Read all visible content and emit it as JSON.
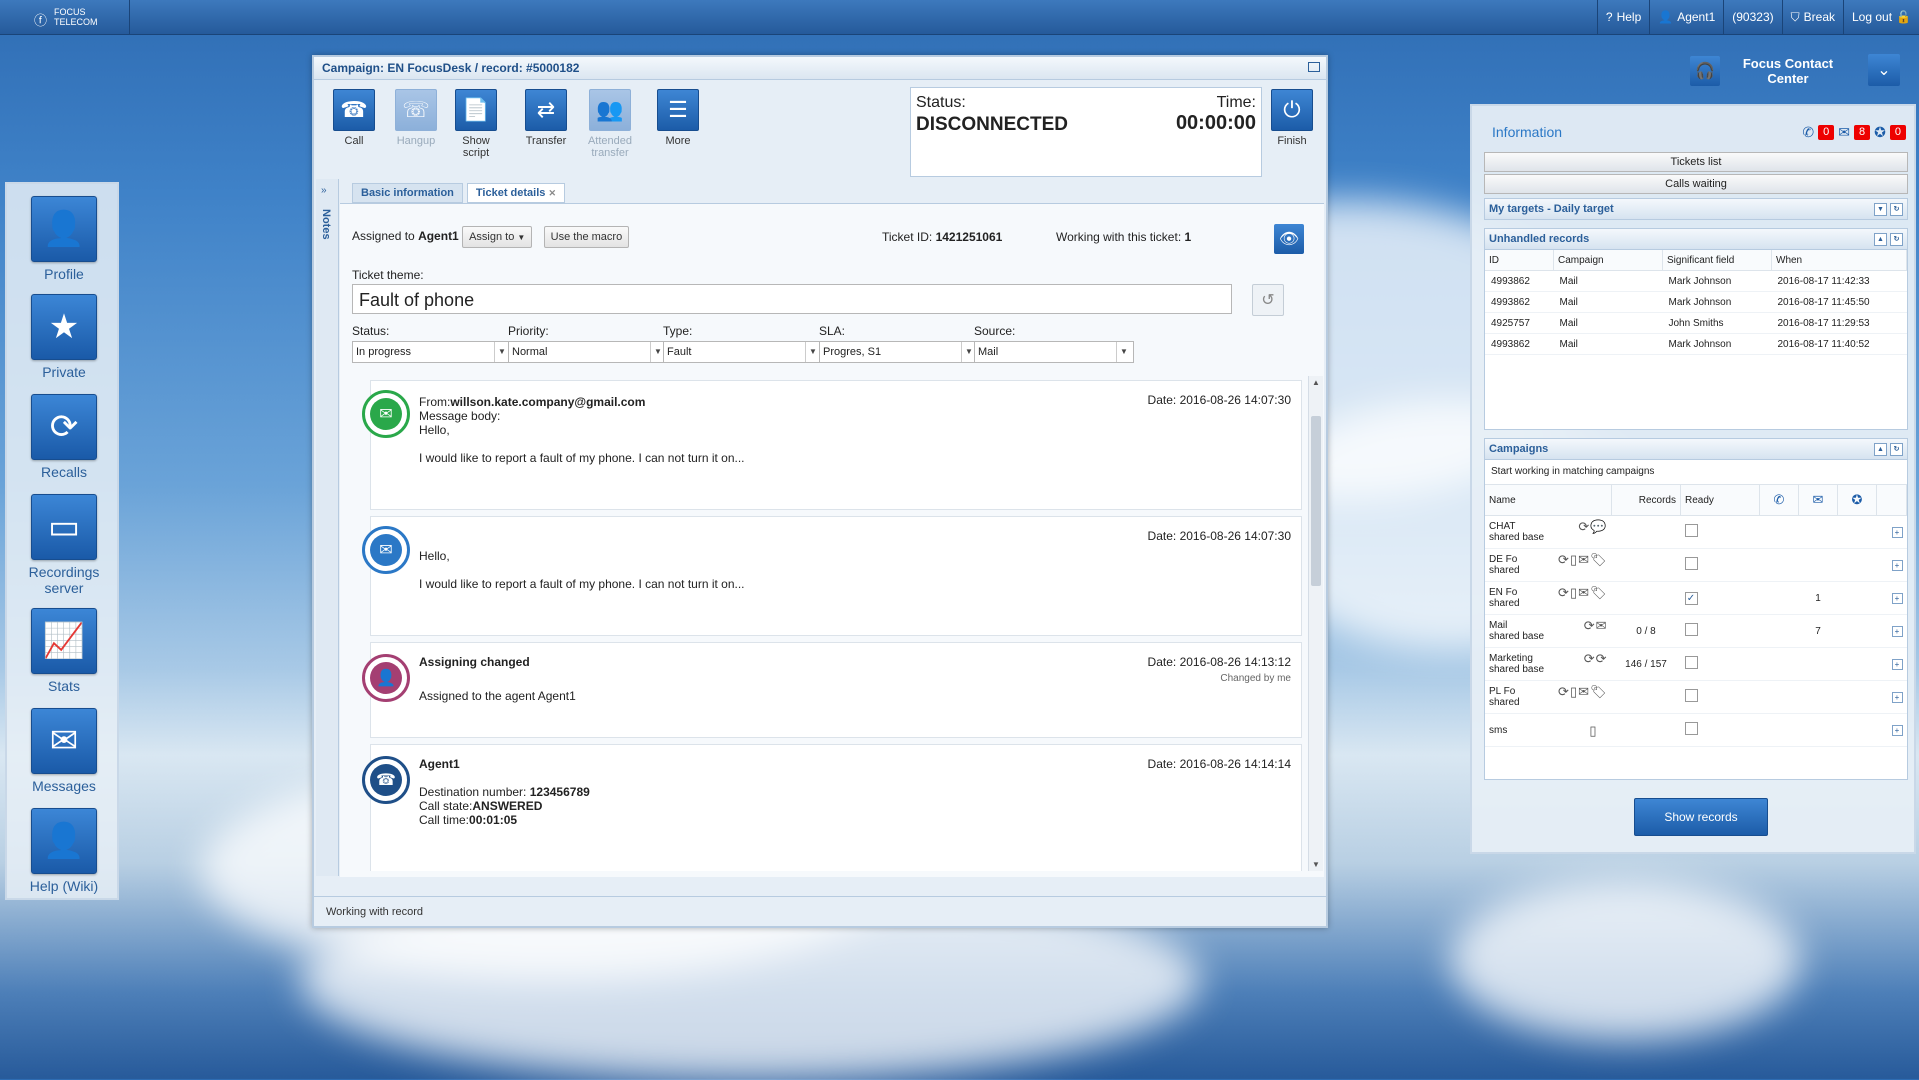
{
  "topbar": {
    "logo_text": "FOCUS TELECOM",
    "help": "Help",
    "agent": "Agent1",
    "agent_id": "(90323)",
    "break": "Break",
    "logout": "Log out"
  },
  "dock": [
    {
      "label": "Profile",
      "icon": "user-icon"
    },
    {
      "label": "Private",
      "icon": "star-icon"
    },
    {
      "label": "Recalls",
      "icon": "recall-icon"
    },
    {
      "label": "Recordings server",
      "icon": "tape-icon"
    },
    {
      "label": "Stats",
      "icon": "chart-icon"
    },
    {
      "label": "Messages",
      "icon": "message-icon"
    },
    {
      "label": "Help (Wiki)",
      "icon": "user-icon"
    }
  ],
  "window": {
    "title": "Campaign: EN FocusDesk / record: #5000182",
    "toolbar": {
      "call": "Call",
      "hangup": "Hangup",
      "show_script": "Show script",
      "transfer": "Transfer",
      "attended_transfer": "Attended transfer",
      "more": "More",
      "finish": "Finish"
    },
    "status_label": "Status:",
    "status_value": "DISCONNECTED",
    "time_label": "Time:",
    "time_value": "00:00:00",
    "notes_label": "Notes",
    "tabs": [
      "Basic information",
      "Ticket details"
    ],
    "assigned_prefix": "Assigned to",
    "assigned_agent": "Agent1",
    "assign_to": "Assign to",
    "use_macro": "Use the macro",
    "ticket_id_label": "Ticket ID:",
    "ticket_id": "1421251061",
    "working_label": "Working with this ticket:",
    "working_count": "1",
    "theme_label": "Ticket theme:",
    "theme_value": "Fault of phone",
    "fields": [
      {
        "label": "Status:",
        "value": "In progress"
      },
      {
        "label": "Priority:",
        "value": "Normal"
      },
      {
        "label": "Type:",
        "value": "Fault"
      },
      {
        "label": "SLA:",
        "value": "Progres, S1"
      },
      {
        "label": "Source:",
        "value": "Mail"
      }
    ],
    "timeline": {
      "e1": {
        "from_prefix": "From:",
        "from": "willson.kate.company@gmail.com",
        "body_label": "Message body:",
        "hello": "Hello,",
        "text": "I would like to report a fault of my phone. I can not turn it on...",
        "date": "Date: 2016-08-26 14:07:30"
      },
      "e2": {
        "hello": "Hello,",
        "text": "I would like to report a fault of my phone. I can not turn it on...",
        "date": "Date: 2016-08-26 14:07:30"
      },
      "e3": {
        "title": "Assigning changed",
        "text": "Assigned to the agent Agent1",
        "date": "Date: 2016-08-26 14:13:12",
        "sub": "Changed by me"
      },
      "e4": {
        "title": "Agent1",
        "dest_label": "Destination number:",
        "dest": "123456789",
        "state_label": "Call state:",
        "state": "ANSWERED",
        "time_label": "Call time:",
        "time": "00:01:05",
        "date": "Date: 2016-08-26 14:14:14"
      }
    },
    "footer": "Working with record"
  },
  "fcc": {
    "title": "Focus Contact Center"
  },
  "info": {
    "title": "Information",
    "badges": {
      "calls": "0",
      "mails": "8",
      "stars": "0"
    },
    "tickets_list": "Tickets list",
    "calls_waiting": "Calls waiting",
    "my_targets": "My targets - Daily target",
    "unhandled_title": "Unhandled records",
    "unhandled_headers": [
      "ID",
      "Campaign",
      "Significant field",
      "When"
    ],
    "unhandled_rows": [
      [
        "4993862",
        "Mail",
        "Mark Johnson",
        "2016-08-17 11:42:33"
      ],
      [
        "4993862",
        "Mail",
        "Mark Johnson",
        "2016-08-17 11:45:50"
      ],
      [
        "4925757",
        "Mail",
        "John Smiths",
        "2016-08-17 11:29:53"
      ],
      [
        "4993862",
        "Mail",
        "Mark Johnson",
        "2016-08-17 11:40:52"
      ]
    ],
    "campaigns_title": "Campaigns",
    "campaigns_sub": "Start working in matching campaigns",
    "campaigns_headers": [
      "Name",
      "Records",
      "Ready"
    ],
    "campaigns_rows": [
      {
        "name": "CHAT",
        "sub": "shared base",
        "records": "",
        "ready": false,
        "mail": ""
      },
      {
        "name": "DE Fo",
        "sub": "shared",
        "records": "",
        "ready": false,
        "mail": ""
      },
      {
        "name": "EN Fo",
        "sub": "shared",
        "records": "",
        "ready": true,
        "mail": "1"
      },
      {
        "name": "Mail",
        "sub": "shared base",
        "records": "0 / 8",
        "ready": false,
        "mail": "7"
      },
      {
        "name": "Marketing",
        "sub": "shared base",
        "records": "146 / 157",
        "ready": false,
        "mail": ""
      },
      {
        "name": "PL Fo",
        "sub": "shared",
        "records": "",
        "ready": false,
        "mail": ""
      },
      {
        "name": "sms",
        "sub": "",
        "records": "",
        "ready": false,
        "mail": ""
      }
    ],
    "show_records": "Show records"
  }
}
